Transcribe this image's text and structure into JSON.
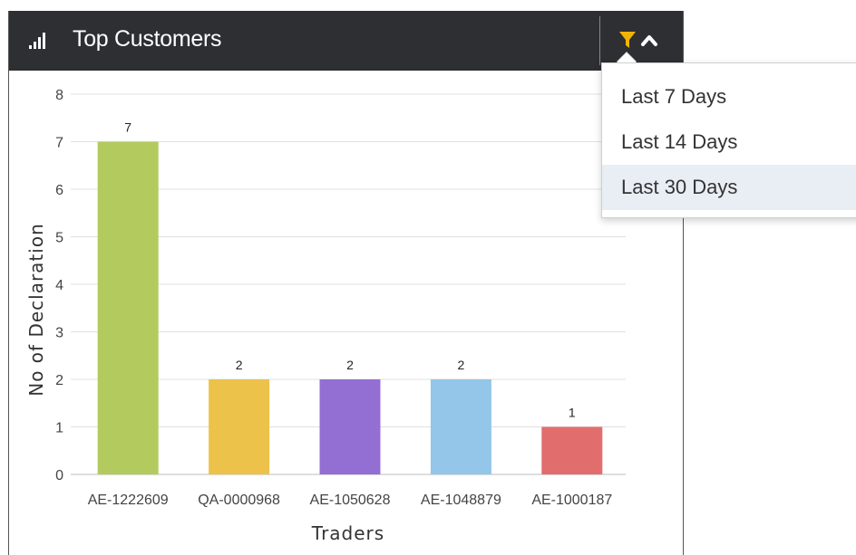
{
  "widget": {
    "title": "Top Customers",
    "icons": {
      "title_icon": "signal-bars-icon",
      "filter": "filter-icon",
      "collapse": "chevron-up-icon"
    },
    "colors": {
      "header_bg": "#2d2f33",
      "filter_icon": "#f0b400"
    }
  },
  "filter_menu": {
    "items": [
      {
        "label": "Last 7 Days"
      },
      {
        "label": "Last 14 Days"
      },
      {
        "label": "Last 30 Days"
      }
    ],
    "highlighted": "Last 30 Days"
  },
  "chart_data": {
    "type": "bar",
    "title": "",
    "xlabel": "Traders",
    "ylabel": "No of Declaration",
    "categories": [
      "AE-1222609",
      "QA-0000968",
      "AE-1050628",
      "AE-1048879",
      "AE-1000187"
    ],
    "values": [
      7,
      2,
      2,
      2,
      1
    ],
    "data_labels": [
      "7",
      "2",
      "2",
      "2",
      "1"
    ],
    "colors": [
      "#b3cb5e",
      "#ecc24a",
      "#946fd3",
      "#93c6e9",
      "#e26d6d"
    ],
    "yticks": [
      0,
      1,
      2,
      3,
      4,
      5,
      6,
      7,
      8
    ],
    "ylim": [
      0,
      8
    ],
    "grid": true,
    "legend": "none"
  }
}
